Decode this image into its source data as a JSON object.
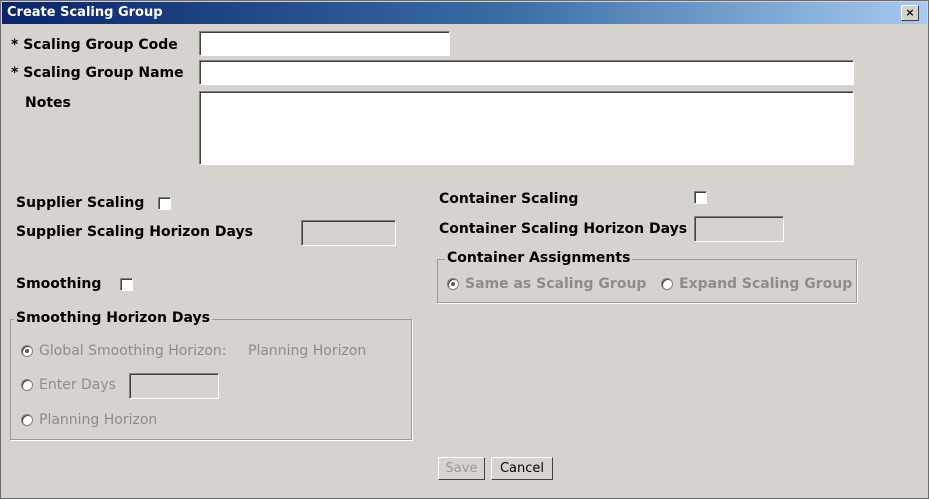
{
  "window": {
    "title": "Create Scaling Group",
    "close_label": "×"
  },
  "form": {
    "code_label": "* Scaling Group Code",
    "code_value": "",
    "name_label": "* Scaling Group Name",
    "name_value": "",
    "notes_label": "Notes",
    "notes_value": ""
  },
  "supplier": {
    "scaling_label": "Supplier Scaling",
    "scaling_checked": false,
    "horizon_label": "Supplier Scaling Horizon Days",
    "horizon_value": ""
  },
  "smoothing": {
    "label": "Smoothing",
    "checked": false,
    "group_title": "Smoothing Horizon Days",
    "options": [
      {
        "label": "Global Smoothing Horizon:",
        "selected": true,
        "value_text": "Planning Horizon"
      },
      {
        "label": "Enter Days",
        "selected": false
      },
      {
        "label": "Planning Horizon",
        "selected": false
      }
    ],
    "enter_days_value": ""
  },
  "container": {
    "scaling_label": "Container Scaling",
    "scaling_checked": false,
    "horizon_label": "Container Scaling Horizon Days",
    "horizon_value": "",
    "assignments_title": "Container Assignments",
    "assignment_options": [
      {
        "label": "Same as Scaling Group",
        "selected": true
      },
      {
        "label": "Expand Scaling Group",
        "selected": false
      }
    ]
  },
  "buttons": {
    "save": "Save",
    "cancel": "Cancel"
  }
}
